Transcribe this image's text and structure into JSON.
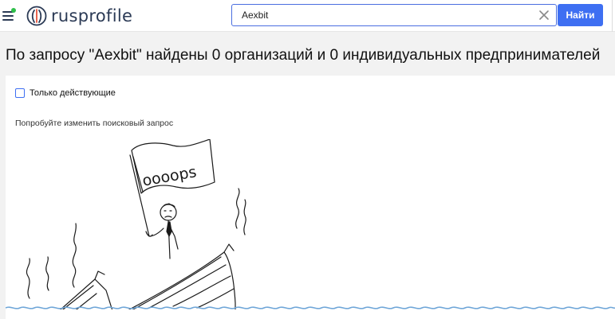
{
  "header": {
    "logo_text": "rusprofile",
    "search_value": "Aexbit",
    "find_button": "Найти",
    "notification_color": "#2fbf4a",
    "accent_color": "#3e6ff2"
  },
  "page": {
    "title": "По запросу \"Aexbit\" найдены 0 организаций и 0 индивидуальных предпринимателей",
    "filter_active_only": "Только действующие",
    "filter_active_checked": false,
    "hint": "Попробуйте изменить поисковый запрос",
    "illustration_flag_text": "oooops"
  }
}
